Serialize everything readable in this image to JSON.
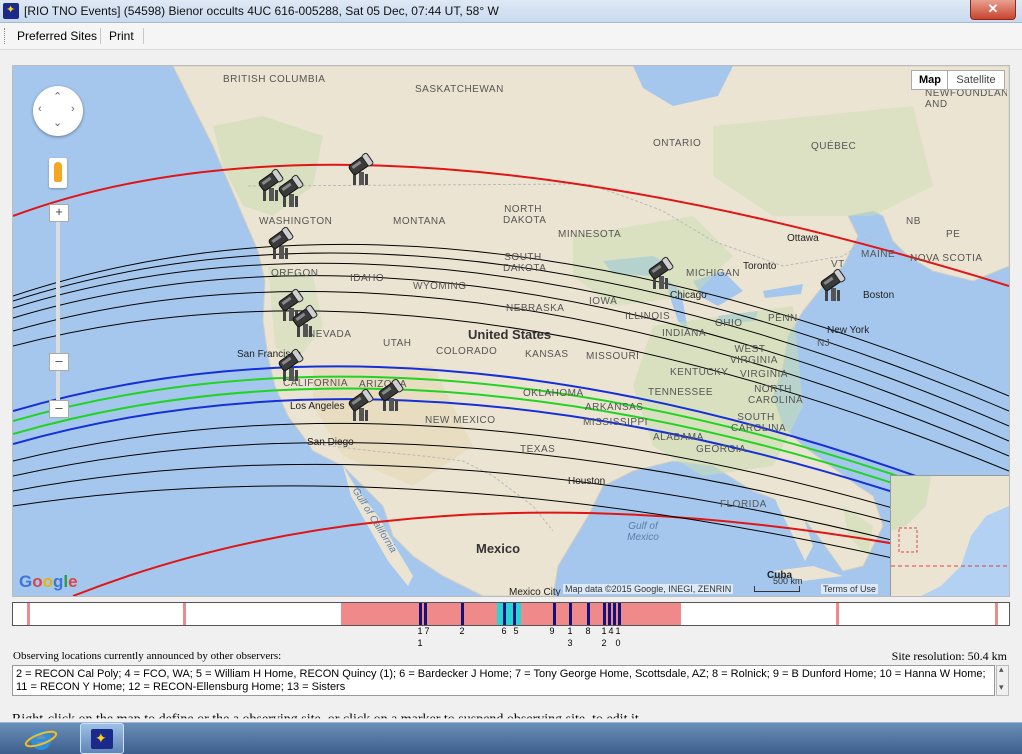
{
  "window": {
    "title": "[RIO TNO Events] (54598) Bienor occults 4UC 616-005288, Sat 05 Dec, 07:44 UT, 58° W",
    "close_label": "✕"
  },
  "menu": {
    "items": [
      "Preferred Sites",
      "Print"
    ]
  },
  "map": {
    "map_type": {
      "map_label": "Map",
      "satellite_label": "Satellite",
      "selected": "Map"
    },
    "attribution": "Map data ©2015 Google, INEGI, ZENRIN",
    "scale_label": "500 km",
    "terms_label": "Terms of Use",
    "google_logo": "Google",
    "labels": {
      "countries": [
        "United States",
        "Mexico",
        "Cuba"
      ],
      "provinces": [
        "BRITISH COLUMBIA",
        "SASKATCHEWAN",
        "ONTARIO",
        "QUÉBEC",
        "NEWFOUNDLAND AND LABRADOR",
        "NB",
        "PE",
        "NOVA SCOTIA"
      ],
      "states": [
        "WASHINGTON",
        "MONTANA",
        "NORTH DAKOTA",
        "MINNESOTA",
        "SOUTH DAKOTA",
        "OREGON",
        "IDAHO",
        "WYOMING",
        "NEBRASKA",
        "IOWA",
        "ILLINOIS",
        "INDIANA",
        "OHIO",
        "MICHIGAN",
        "PENN",
        "NEVADA",
        "UTAH",
        "COLORADO",
        "KANSAS",
        "MISSOURI",
        "KENTUCKY",
        "WEST VIRGINIA",
        "VIRGINIA",
        "NORTH CAROLINA",
        "CALIFORNIA",
        "ARIZONA",
        "NEW MEXICO",
        "OKLAHOMA",
        "ARKANSAS",
        "TENNESSEE",
        "MISSISSIPPI",
        "ALABAMA",
        "GEORGIA",
        "SOUTH CAROLINA",
        "TEXAS",
        "FLORIDA",
        "MAINE",
        "VT",
        "NJ"
      ],
      "cities": [
        "Ottawa",
        "Toronto",
        "Boston",
        "New York",
        "San Francisco",
        "Los Angeles",
        "San Diego",
        "Houston",
        "Chicago",
        "Mexico City"
      ],
      "waters": [
        "Gulf of California",
        "Gulf of Mexico"
      ]
    },
    "icons": {
      "telescope": "telescope-icon",
      "navigation": "pan-control-icon",
      "pegman": "pegman-icon"
    },
    "colors": {
      "limit_line": "#e01515",
      "shadow_edge": "#1530d8",
      "center_line": "#21d421",
      "sigma_lines": "#000000",
      "land": "#ece4d2",
      "water": "#a5c7ee"
    }
  },
  "strip": {
    "numbers_row1": [
      "1",
      "7",
      "2",
      "6",
      "5",
      "9",
      "1",
      "8",
      "1",
      "4",
      "1"
    ],
    "numbers_row2": [
      "1",
      "3",
      "2",
      "0"
    ]
  },
  "observers": {
    "heading": "Observing locations currently announced by other observers:",
    "resolution": "Site resolution: 50.4 km",
    "list_text": "2 = RECON Cal Poly; 4 = FCO, WA; 5 = William H Home, RECON Quincy (1); 6 = Bardecker J Home; 7 = Tony George Home, Scottsdale, AZ; 8 = Rolnick; 9 = B Dunford Home; 10 = Hanna W Home; 11 = RECON Y Home; 12 = RECON-Ellensburg Home; 13 = Sisters"
  },
  "footer": {
    "truncated_text": "Right-click on the map to define or the a observing site, or click on a marker to suspend observing site, to edit it"
  }
}
